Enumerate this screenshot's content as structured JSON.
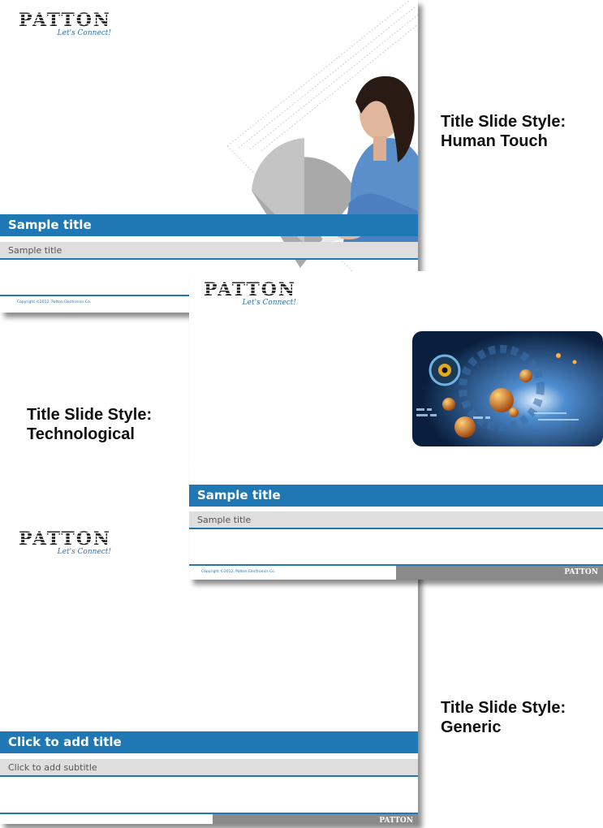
{
  "brand": {
    "name": "PATTON",
    "tagline": "Let's Connect!"
  },
  "slides": [
    {
      "style_label_line1": "Title Slide Style:",
      "style_label_line2": "Human Touch",
      "title": "Sample title",
      "subtitle": "Sample title",
      "copyright": "Copyright ©2012, Patton Electronics Co."
    },
    {
      "style_label_line1": "Title Slide Style:",
      "style_label_line2": "Technological",
      "title": "Sample title",
      "subtitle": "Sample title",
      "copyright": "Copyright ©2012, Patton Electronics Co.",
      "footer_logo": "PATTON"
    },
    {
      "style_label_line1": "Title Slide Style:",
      "style_label_line2": "Generic",
      "title": "Click to add title",
      "subtitle": "Click to add subtitle",
      "footer_logo": "PATTON"
    }
  ],
  "colors": {
    "accent": "#1f78b4",
    "subtitle_bar": "#dedede",
    "footer_gray": "#8a8a8a"
  }
}
